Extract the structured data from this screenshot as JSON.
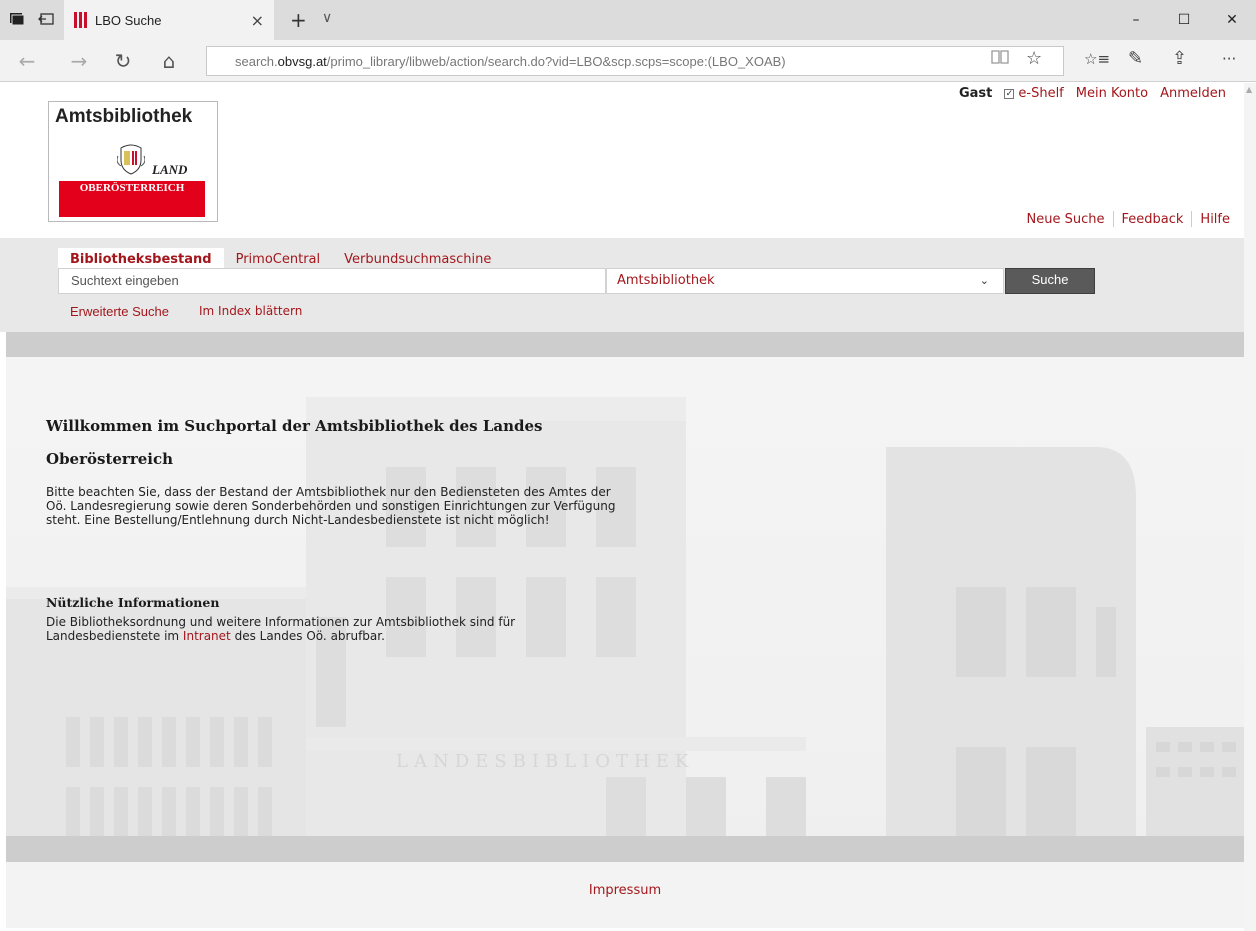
{
  "browser": {
    "tab_title": "LBO Suche",
    "tab_close": "×",
    "new_tab": "+",
    "tab_menu": "∨",
    "url_prefix": "search.",
    "url_domain": "obvsg.at",
    "url_rest": "/primo_library/libweb/action/search.do?vid=LBO&scp.scps=scope:(LBO_XOAB)",
    "nav": {
      "back": "←",
      "forward": "→",
      "refresh": "↻",
      "home": "⌂"
    },
    "window": {
      "minimize": "–",
      "maximize": "☐",
      "close": "✕"
    },
    "toolbar": {
      "reading": "📖",
      "favorite": "☆",
      "favorites_hub": "☆≡",
      "notes": "✎",
      "share": "⇪",
      "more": "···"
    },
    "accent": "#c8102e"
  },
  "logo": {
    "title": "Amtsbibliothek",
    "land": "LAND",
    "region": "OBERÖSTERREICH"
  },
  "usernav": {
    "guest": "Gast",
    "eshelf_check": "✓",
    "eshelf": "e-Shelf",
    "account": "Mein Konto",
    "login": "Anmelden"
  },
  "toplinks": {
    "new_search": "Neue Suche",
    "feedback": "Feedback",
    "help": "Hilfe"
  },
  "search": {
    "tabs": [
      "Bibliotheksbestand",
      "PrimoCentral",
      "Verbundsuchmaschine"
    ],
    "placeholder": "Suchtext eingeben",
    "scope": "Amtsbibliothek",
    "chevron": "⌄",
    "button": "Suche",
    "advanced": "Erweiterte Suche",
    "browse": "Im Index blättern"
  },
  "content": {
    "welcome_line1": "Willkommen im Suchportal der Amtsbibliothek des Landes",
    "welcome_line2": "Oberösterreich",
    "intro": "Bitte beachten Sie, dass der Bestand der Amtsbibliothek nur den Bediensteten des Amtes der Oö. Landesregierung sowie deren Sonderbehörden und sonstigen Einrichtungen zur Verfügung steht. Eine Bestellung/Entlehnung durch Nicht-Landesbedienstete ist nicht möglich!",
    "info_heading": "Nützliche Informationen",
    "info_text_before": "Die Bibliotheksordnung und weitere Informationen zur Amtsbibliothek sind für Landesbedienstete im ",
    "info_link": "Intranet",
    "info_text_after": " des Landes Oö. abrufbar.",
    "building_lettering": "LANDESBIBLIOTHEK"
  },
  "footer": {
    "impressum": "Impressum"
  },
  "colors": {
    "link": "#a3171c",
    "brand_red": "#e2001a",
    "button": "#5a5a5a",
    "band": "#cdcdcd"
  }
}
